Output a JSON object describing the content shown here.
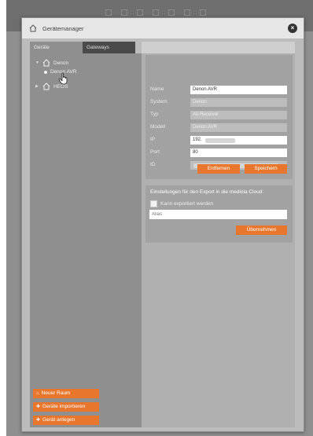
{
  "dialog": {
    "title": "Gerätemanager"
  },
  "tabs": [
    {
      "label": "Geräte",
      "active": true
    },
    {
      "label": "Gateways",
      "active": false
    }
  ],
  "tree": {
    "nodes": [
      {
        "label": "Denon",
        "expanded": true,
        "children": [
          {
            "label": "Denon AVR"
          }
        ]
      },
      {
        "label": "HEOS",
        "expanded": false
      }
    ]
  },
  "left_buttons": {
    "new_room": "Neuer Raum",
    "import_devices": "Geräte importieren",
    "create_device": "Gerät anlegen"
  },
  "device_form": {
    "name": {
      "label": "Name",
      "value": "Denon AVR"
    },
    "system": {
      "label": "System",
      "value": "Denon"
    },
    "type": {
      "label": "Typ",
      "value": "AV-Receiver"
    },
    "model": {
      "label": "Modell",
      "value": "Denon AVR"
    },
    "ip": {
      "label": "IP",
      "value": "192."
    },
    "port": {
      "label": "Port",
      "value": "80"
    },
    "id": {
      "label": "ID",
      "value": ""
    },
    "remove_label": "Entfernen",
    "save_label": "Speichern"
  },
  "export": {
    "title": "Einstellungen für den Export in die mediola Cloud:",
    "checkbox_label": "Kann exportiert werden",
    "checked": false,
    "alias_placeholder": "Alias",
    "apply_label": "Übernehmen"
  },
  "colors": {
    "accent": "#e8772d",
    "panel": "#8f8f8f",
    "dialog": "#bcbcbc"
  }
}
